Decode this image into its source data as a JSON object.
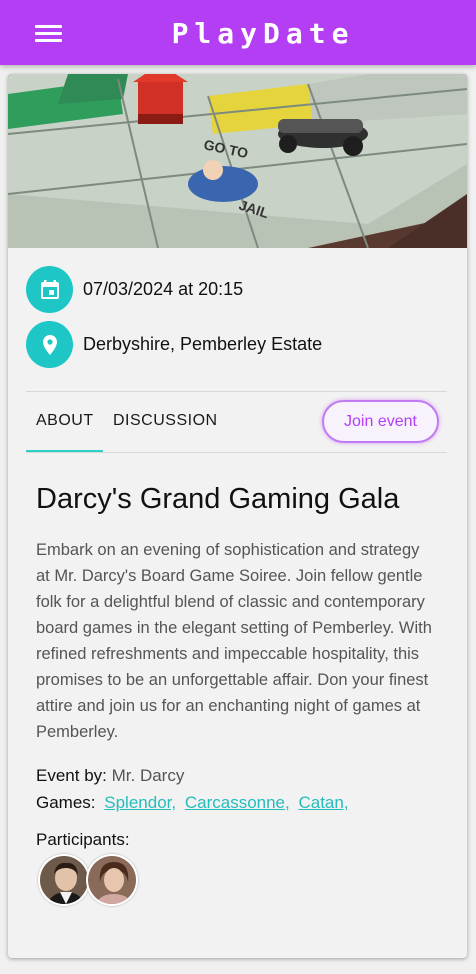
{
  "app": {
    "title": "PlayDate"
  },
  "event": {
    "datetime": "07/03/2024 at 20:15",
    "location": "Derbyshire, Pemberley Estate",
    "title": "Darcy's Grand Gaming Gala",
    "description": "Embark on an evening of sophistication and strategy at Mr. Darcy's Board Game Soiree. Join fellow gentle folk for a delightful blend of classic and contemporary board games in the elegant setting of Pemberley. With refined refreshments and impeccable hospitality, this promises to be an unforgettable affair. Don your finest attire and join us for an enchanting night of games at Pemberley.",
    "event_by_label": "Event by:",
    "event_by": "Mr. Darcy",
    "games_label": "Games:",
    "games": [
      "Splendor,",
      "Carcassonne,",
      "Catan,"
    ],
    "participants_label": "Participants:",
    "participants": [
      "participant-avatar-1",
      "participant-avatar-2"
    ]
  },
  "tabs": {
    "about": "About",
    "discussion": "Discussion",
    "active": "about"
  },
  "actions": {
    "join": "Join event"
  },
  "icons": {
    "menu": "menu-icon",
    "calendar": "calendar-icon",
    "location": "location-pin-icon"
  },
  "colors": {
    "appbar": "#b43ef4",
    "accent": "#1ec6c6",
    "join": "#b43ef4"
  }
}
